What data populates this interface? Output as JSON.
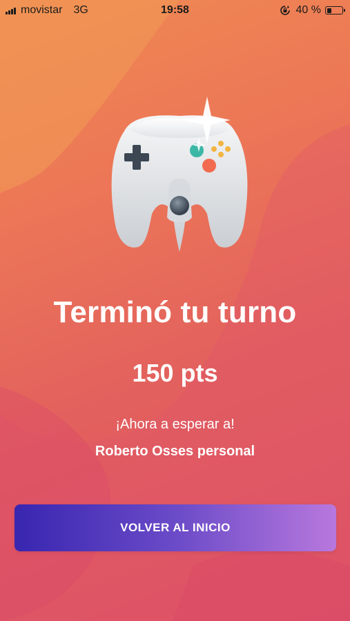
{
  "status_bar": {
    "carrier": "movistar",
    "network": "3G",
    "time": "19:58",
    "battery_percent": "40 %",
    "battery_level": 0.4,
    "signal_icon": "signal-bars-icon",
    "rotation_lock_icon": "rotation-lock-icon",
    "battery_icon": "battery-icon"
  },
  "hero": {
    "icon": "game-controller-icon",
    "sparkle_icon": "sparkle-icon"
  },
  "result": {
    "title": "Terminó tu turno",
    "points": "150 pts",
    "waiting_text": "¡Ahora a esperar a!",
    "opponent_name": "Roberto Osses personal"
  },
  "actions": {
    "back_home_label": "VOLVER AL INICIO"
  },
  "colors": {
    "background_top": "#f08a52",
    "background_bottom": "#dc4f66",
    "button_start": "#3826b0",
    "button_end": "#b878dd",
    "text": "#ffffff"
  }
}
